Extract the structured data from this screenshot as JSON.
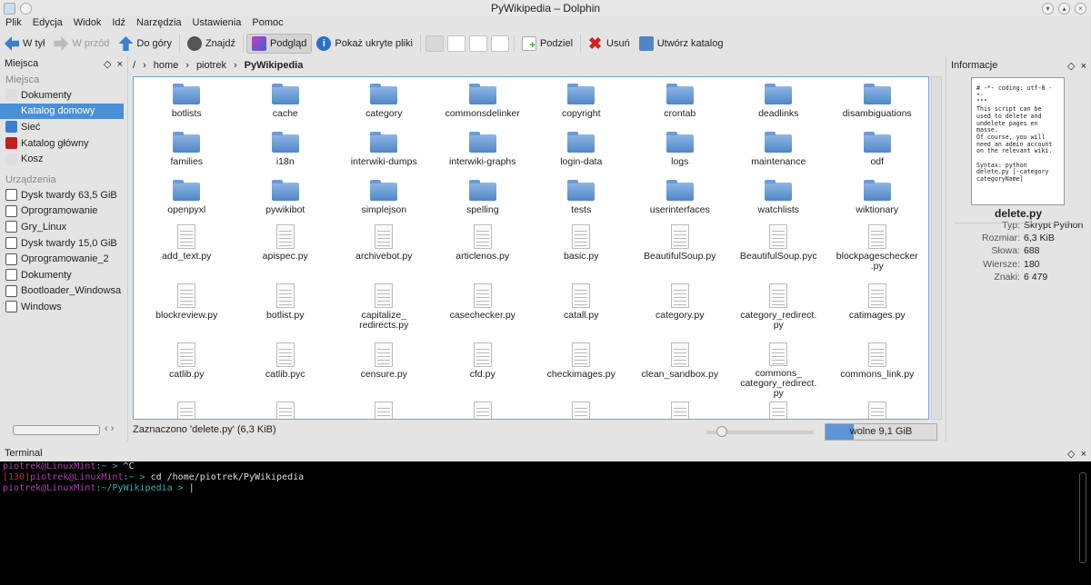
{
  "window": {
    "title": "PyWikipedia – Dolphin"
  },
  "menu": [
    "Plik",
    "Edycja",
    "Widok",
    "Idź",
    "Narzędzia",
    "Ustawienia",
    "Pomoc"
  ],
  "toolbar": {
    "back": "W tył",
    "forward": "W przód",
    "up": "Do góry",
    "find": "Znajdź",
    "preview": "Podgląd",
    "hidden": "Pokaż ukryte pliki",
    "split": "Podziel",
    "delete": "Usuń",
    "newdir": "Utwórz katalog"
  },
  "places": {
    "title": "Miejsca",
    "section_places": "Miejsca",
    "items": [
      "Dokumenty",
      "Katalog domowy",
      "Sieć",
      "Katalog główny",
      "Kosz"
    ],
    "section_devices": "Urządzenia",
    "devices": [
      "Dysk twardy 63,5 GiB",
      "Oprogramowanie",
      "Gry_Linux",
      "Dysk twardy 15,0 GiB",
      "Oprogramowanie_2",
      "Dokumenty",
      "Bootloader_Windowsa",
      "Windows"
    ]
  },
  "breadcrumb": [
    "/",
    "home",
    "piotrek",
    "PyWikipedia"
  ],
  "folders": [
    "botlists",
    "cache",
    "category",
    "commonsdelinker",
    "copyright",
    "crontab",
    "deadlinks",
    "disambiguations",
    "families",
    "i18n",
    "interwiki-dumps",
    "interwiki-graphs",
    "login-data",
    "logs",
    "maintenance",
    "odf",
    "openpyxl",
    "pywikibot",
    "simplejson",
    "spelling",
    "tests",
    "userinterfaces",
    "watchlists",
    "wiktionary"
  ],
  "files": [
    "add_text.py",
    "apispec.py",
    "archivebot.py",
    "articlenos.py",
    "basic.py",
    "BeautifulSoup.py",
    "BeautifulSoup.pyc",
    "blockpageschecker\n.py",
    "blockreview.py",
    "botlist.py",
    "capitalize_\nredirects.py",
    "casechecker.py",
    "catall.py",
    "category.py",
    "category_redirect.\npy",
    "catimages.py",
    "catlib.py",
    "catlib.pyc",
    "censure.py",
    "cfd.py",
    "checkimages.py",
    "clean_sandbox.py",
    "commons_\ncategory_redirect.\npy",
    "commons_link.py"
  ],
  "info": {
    "title": "Informacje",
    "preview_text": "# -*- coding: utf-8 -*-\n\"\"\"\nThis script can be used to delete and undelete pages en masse.\nOf course, you will need an admin account on the relevant wiki.\n\nSyntax: python delete.py [-category categoryName]",
    "filename": "delete.py",
    "meta": [
      {
        "k": "Typ:",
        "v": "Skrypt Python"
      },
      {
        "k": "Rozmiar:",
        "v": "6,3 KiB"
      },
      {
        "k": "Słowa:",
        "v": "688"
      },
      {
        "k": "Wiersze:",
        "v": "180"
      },
      {
        "k": "Znaki:",
        "v": "6 479"
      }
    ]
  },
  "status": {
    "text": "Zaznaczono 'delete.py' (6,3 KiB)",
    "free": "wolne 9,1 GiB",
    "free_used_fraction": 0.25
  },
  "terminal": {
    "title": "Terminal",
    "lines": [
      [
        {
          "t": "piotrek@LinuxMint",
          "c": "p"
        },
        {
          "t": ":~ > ",
          "c": "c"
        },
        {
          "t": "^C",
          "c": "w"
        }
      ],
      [
        {
          "t": "[130]",
          "c": "r"
        },
        {
          "t": "piotrek@LinuxMint",
          "c": "p"
        },
        {
          "t": ":~ > ",
          "c": "c"
        },
        {
          "t": " cd /home/piotrek/PyWikipedia",
          "c": "w"
        }
      ],
      [
        {
          "t": "piotrek@LinuxMint",
          "c": "p"
        },
        {
          "t": ":~/PyWikipedia > ",
          "c": "c"
        },
        {
          "t": "|",
          "c": "w"
        }
      ]
    ]
  }
}
